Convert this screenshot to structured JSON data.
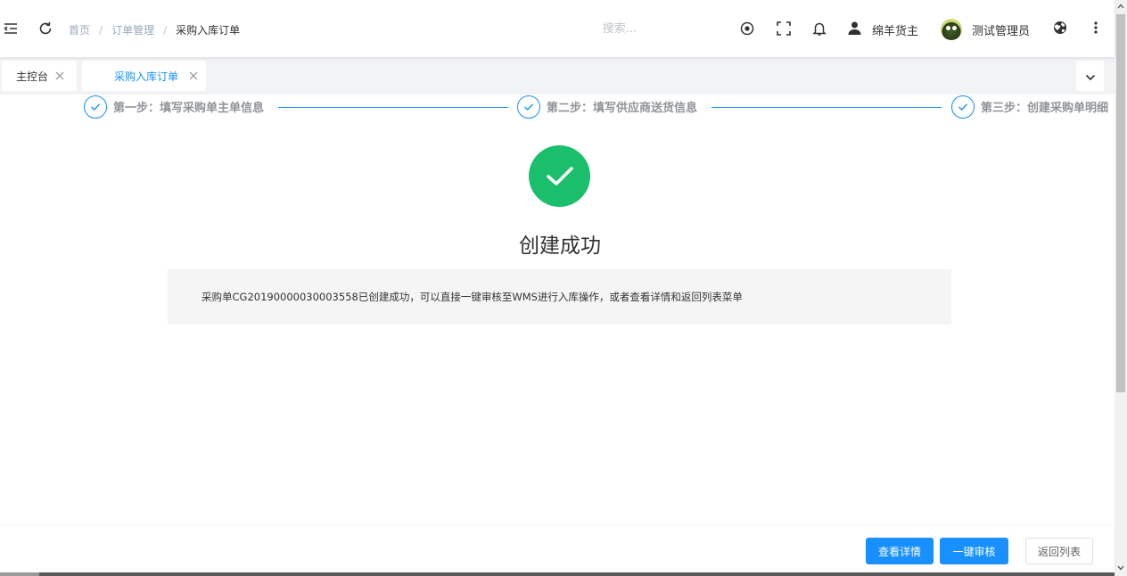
{
  "header": {
    "breadcrumb": [
      "首页",
      "订单管理",
      "采购入库订单"
    ],
    "search_placeholder": "搜索...",
    "owner_name": "绵羊货主",
    "admin_name": "测试管理员"
  },
  "tags": {
    "home_label": "主控台",
    "active_label": "采购入库订单"
  },
  "steps": [
    {
      "title": "第一步：填写采购单主单信息"
    },
    {
      "title": "第二步：填写供应商送货信息"
    },
    {
      "title": "第三步：创建采购单明细"
    }
  ],
  "result": {
    "title": "创建成功",
    "message": "采购单CG2019000003000355​8已创建成功，可以直接一键审核至WMS进行入库操作，或者查看详情和返回列表菜单"
  },
  "footer": {
    "detail_label": "查看详情",
    "audit_label": "一键审核",
    "back_label": "返回列表"
  },
  "colors": {
    "primary": "#1890ff",
    "success": "#1bbf6b"
  },
  "icons": [
    "menu-fold-icon",
    "refresh-icon",
    "target-icon",
    "fullscreen-icon",
    "bell-icon",
    "user-icon",
    "globe-icon",
    "more-vertical-icon",
    "close-icon",
    "chevron-down-icon",
    "check-icon",
    "chevron-up-icon"
  ]
}
